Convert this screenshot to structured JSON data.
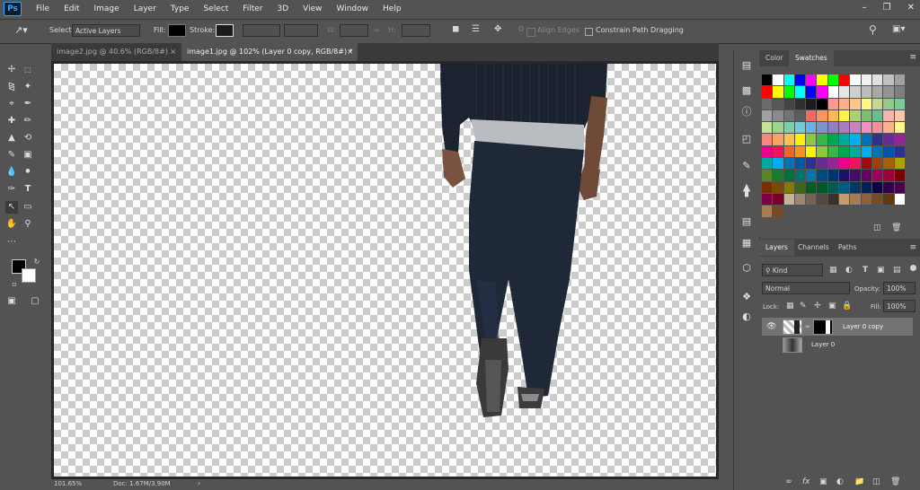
{
  "app": {
    "logo": "Ps"
  },
  "menu": [
    "File",
    "Edit",
    "Image",
    "Layer",
    "Type",
    "Select",
    "Filter",
    "3D",
    "View",
    "Window",
    "Help"
  ],
  "options_bar": {
    "select_label": "Select:",
    "select_value": "Active Layers",
    "fill_label": "Fill:",
    "stroke_label": "Stroke:",
    "w_label": "W:",
    "h_label": "H:",
    "align_edges": "Align Edges",
    "constrain": "Constrain Path Dragging"
  },
  "tabs": [
    {
      "label": "image2.jpg @ 40.6% (RGB/8#)",
      "active": false
    },
    {
      "label": "image1.jpg @ 102% (Layer 0 copy, RGB/8#) *",
      "active": true
    }
  ],
  "status": {
    "zoom": "101.65%",
    "doc": "Doc: 1.67M/3.90M"
  },
  "color_panel": {
    "tabs": [
      "Color",
      "Swatches"
    ],
    "active_tab": "Swatches",
    "swatches": [
      "#000000",
      "#ffffff",
      "#00ffff",
      "#0000ff",
      "#ff00ff",
      "#ffff00",
      "#00ff00",
      "#ff0000",
      "#ffffff",
      "#f0f0f0",
      "#e0e0e0",
      "#c0c0c0",
      "#a0a0a0",
      "#ff0000",
      "#ffff00",
      "#00ff00",
      "#00ffff",
      "#0000ff",
      "#ff00ff",
      "#ffffff",
      "#e6e6e6",
      "#d0d0d0",
      "#bcbcbc",
      "#a8a8a8",
      "#939393",
      "#7f7f7f",
      "#6b6b6b",
      "#575757",
      "#444444",
      "#303030",
      "#1c1c1c",
      "#000000",
      "#f79a8f",
      "#f9b08c",
      "#fcc88a",
      "#fff784",
      "#c3d98c",
      "#94c98d",
      "#7bc89a",
      "#a0a0a0",
      "#8a8a8a",
      "#737373",
      "#5c5c5c",
      "#f26c5c",
      "#f89558",
      "#fcb955",
      "#fff44f",
      "#abd26f",
      "#7dbf6e",
      "#65c08d",
      "#f4b4b0",
      "#f9c7aa",
      "#c5e098",
      "#9ed48e",
      "#7ccfa7",
      "#70cbd5",
      "#6bb2e4",
      "#7d93cc",
      "#8f80be",
      "#a77fbf",
      "#c683c0",
      "#f08fc0",
      "#f68f9b",
      "#fdb291",
      "#fff68f",
      "#f5897d",
      "#f7a266",
      "#fbc14f",
      "#fff200",
      "#8dc63f",
      "#39b54a",
      "#00a651",
      "#00a99d",
      "#00aeef",
      "#0072bc",
      "#2e3192",
      "#662d91",
      "#92278f",
      "#ec008c",
      "#ed145b",
      "#f26522",
      "#f7941d",
      "#fff200",
      "#8dc63f",
      "#39b54a",
      "#00a651",
      "#00a99d",
      "#00aeef",
      "#0072bc",
      "#0054a6",
      "#2e3192",
      "#00a99d",
      "#00aeef",
      "#0072bc",
      "#0054a6",
      "#2e3192",
      "#662d91",
      "#92278f",
      "#ec008c",
      "#ed145b",
      "#9e0b0f",
      "#a0410d",
      "#a36209",
      "#aba000",
      "#598527",
      "#197b30",
      "#007236",
      "#00746b",
      "#0076a3",
      "#004a80",
      "#003471",
      "#1b1464",
      "#440e62",
      "#630460",
      "#9e005d",
      "#9e0039",
      "#790000",
      "#7b2e00",
      "#7d4900",
      "#827b00",
      "#406618",
      "#005e20",
      "#005826",
      "#005952",
      "#005b7f",
      "#003663",
      "#002157",
      "#0d004c",
      "#32004b",
      "#4b0049",
      "#7b0046",
      "#7a0026",
      "#c7b299",
      "#998675",
      "#736357",
      "#534741",
      "#37302d",
      "#c69c6d",
      "#a67c52",
      "#8c6239",
      "#754c24",
      "#603913",
      "#ffffff",
      "#a67c52",
      "#754c24"
    ]
  },
  "layers_panel": {
    "tabs": [
      "Layers",
      "Channels",
      "Paths"
    ],
    "active_tab": "Layers",
    "kind": "Kind",
    "blend_mode": "Normal",
    "opacity_label": "Opacity:",
    "opacity": "100%",
    "lock_label": "Lock:",
    "fill_label": "Fill:",
    "fill": "100%",
    "layers": [
      {
        "name": "Layer 0 copy",
        "visible": true,
        "selected": true,
        "masked": true
      },
      {
        "name": "Layer 0",
        "visible": false,
        "selected": false,
        "masked": false
      }
    ]
  },
  "colors": {
    "foreground": "#000000",
    "background": "#ffffff",
    "accent": "#31a8ff",
    "shirt": "#1e2533",
    "jeans": "#222c3a"
  }
}
